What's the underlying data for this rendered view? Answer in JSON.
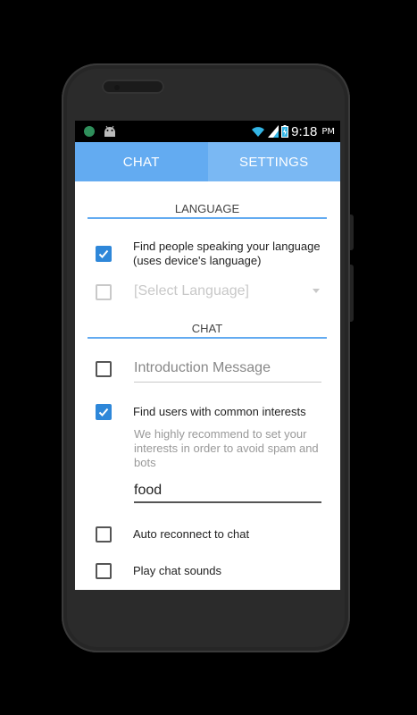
{
  "statusbar": {
    "time": "9:18",
    "ampm": "PM"
  },
  "tabs": [
    {
      "label": "CHAT",
      "active": false
    },
    {
      "label": "SETTINGS",
      "active": true
    }
  ],
  "language_section": {
    "title": "LANGUAGE",
    "find_people_label_line1": "Find people speaking your language",
    "find_people_label_line2": "(uses device's language)",
    "select_language_placeholder": "[Select Language]"
  },
  "chat_section": {
    "title": "CHAT",
    "intro_placeholder": "Introduction Message",
    "common_interests_label": "Find users with common interests",
    "hint_line1": "We highly recommend to set your",
    "hint_line2": "interests in order to avoid spam and",
    "hint_line3": "bots",
    "interests_value": "food",
    "auto_reconnect_label": "Auto reconnect to chat",
    "play_sounds_label": "Play chat sounds"
  },
  "colors": {
    "accent": "#63abf1",
    "checkbox": "#2e87d9"
  }
}
